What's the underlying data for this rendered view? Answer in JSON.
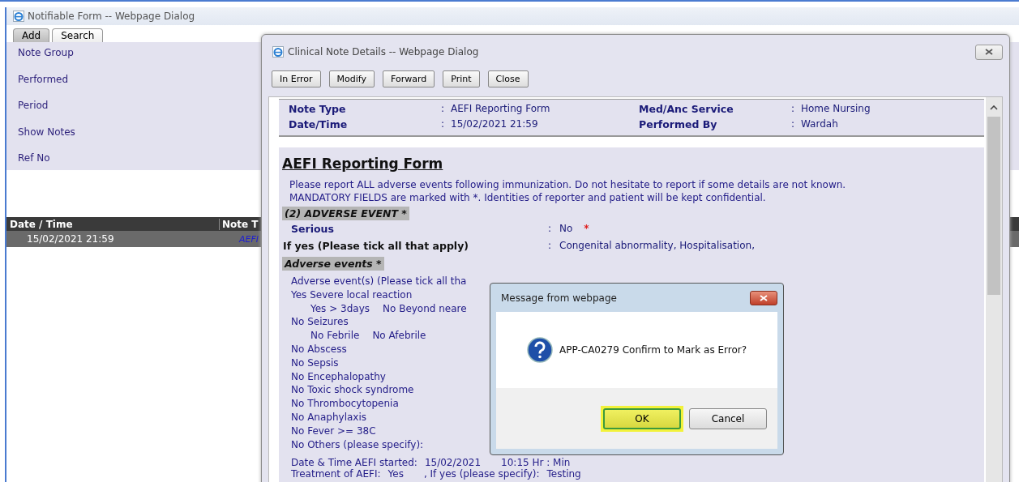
{
  "window": {
    "title": "Notifiable Form -- Webpage Dialog"
  },
  "tabs": [
    {
      "label": "Add",
      "selected": false
    },
    {
      "label": "Search",
      "selected": true
    }
  ],
  "search_fields": [
    "Note Group",
    "Performed",
    "Period",
    "Show Notes",
    "Ref No"
  ],
  "notes_table": {
    "columns": [
      "Date / Time",
      "Note T"
    ],
    "rows": [
      {
        "cells": [
          "15/02/2021 21:59",
          "AEFI"
        ],
        "selected": true
      }
    ]
  },
  "dialog": {
    "title": "Clinical Note Details -- Webpage Dialog",
    "buttons": [
      "In Error",
      "Modify",
      "Forward",
      "Print",
      "Close"
    ],
    "summary": [
      {
        "label": "Note Type",
        "separator": ":",
        "value": "AEFI Reporting Form"
      },
      {
        "label": "Med/Anc Service",
        "separator": ":",
        "value": "Home Nursing"
      },
      {
        "label": "Date/Time",
        "separator": ":",
        "value": "15/02/2021 21:59"
      },
      {
        "label": "Performed By",
        "separator": ":",
        "value": "Wardah"
      }
    ],
    "form": {
      "heading": "AEFI Reporting Form",
      "intro": [
        "Please report ALL adverse events following immunization. Do not hesitate to report if some details are not known.",
        "MANDATORY FIELDS are marked with *. Identities of reporter and patient will be kept confidential."
      ],
      "blocks": [
        {
          "kind": "section",
          "title": "(2) ADVERSE EVENT *"
        },
        {
          "kind": "field",
          "label": "Serious",
          "separator": ":",
          "value": "No",
          "mark": "*",
          "strong": false
        },
        {
          "kind": "field",
          "label": "If yes (Please tick all that apply)",
          "separator": ":",
          "value": "Congenital abnormality, Hospitalisation,",
          "strong": true
        },
        {
          "kind": "section",
          "title": "Adverse events *"
        },
        {
          "kind": "list",
          "items": [
            {
              "text": "Adverse event(s) (Please tick all tha"
            },
            {
              "text": "Yes Severe local reaction",
              "children": [
                {
                  "text": "Yes > 3days"
                },
                {
                  "text": "No Beyond neare"
                }
              ]
            },
            {
              "text": "No Seizures",
              "children": [
                {
                  "text": "No Febrile"
                },
                {
                  "text": "No Afebrile"
                }
              ]
            },
            {
              "text": "No Abscess"
            },
            {
              "text": "No Sepsis"
            },
            {
              "text": "No Encephalopathy"
            },
            {
              "text": "No Toxic shock syndrome"
            },
            {
              "text": "No Thrombocytopenia"
            },
            {
              "text": "No Anaphylaxis"
            },
            {
              "text": "No Fever >= 38C"
            },
            {
              "text": "No Others (please specify):"
            }
          ]
        },
        {
          "kind": "line",
          "parts": [
            "Date & Time AEFI started:",
            "15/02/2021",
            "10:15 Hr : Min"
          ]
        },
        {
          "kind": "line",
          "parts": [
            "Treatment of AEFI:",
            "Yes",
            ", If yes (please specify):",
            "Testing"
          ]
        }
      ]
    }
  },
  "message_box": {
    "title": "Message from webpage",
    "text": "APP-CA0279 Confirm to Mark as Error?",
    "buttons": [
      {
        "label": "OK",
        "focused": true
      },
      {
        "label": "Cancel",
        "focused": false
      }
    ]
  }
}
